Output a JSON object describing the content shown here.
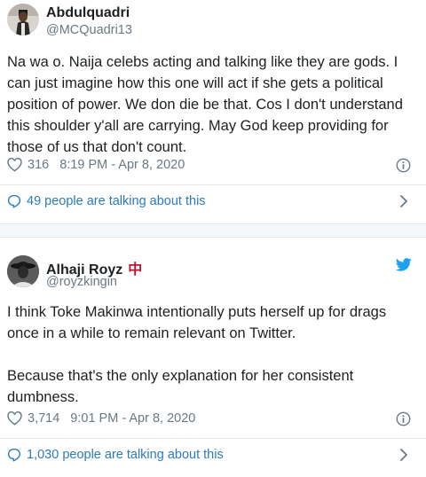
{
  "tweets": [
    {
      "name": "Abdulquadri",
      "handle": "@MCQuadri13",
      "text": [
        "Na wa o. Naija celebs acting and talking like they are gods. I can just imagine how this one will act if she gets a political position of power. We don die be that. Cos I don't understand this shoulder y'all are carrying. May God keep providing for those of us that don't count."
      ],
      "likes": "316",
      "timestamp": "8:19 PM - Apr 8, 2020",
      "talking": "49 people are talking about this"
    },
    {
      "name": "Alhaji Royz",
      "name_badge": "中",
      "handle": "@royzkingin",
      "text": [
        "I think Toke Makinwa intentionally puts herself up for drags once in a while to remain relevant on Twitter.",
        "Because that's the only explanation for her consistent dumbness."
      ],
      "likes": "3,714",
      "timestamp": "9:01 PM - Apr 8, 2020",
      "talking": "1,030 people are talking about this"
    }
  ],
  "colors": {
    "link": "#2b7bb9",
    "muted": "#697882",
    "twitter_blue": "#1da1f2",
    "badge_red": "#c8102e"
  },
  "icons": [
    "heart-icon",
    "info-icon",
    "speech-bubble-icon",
    "chevron-right-icon",
    "twitter-bird-icon"
  ]
}
